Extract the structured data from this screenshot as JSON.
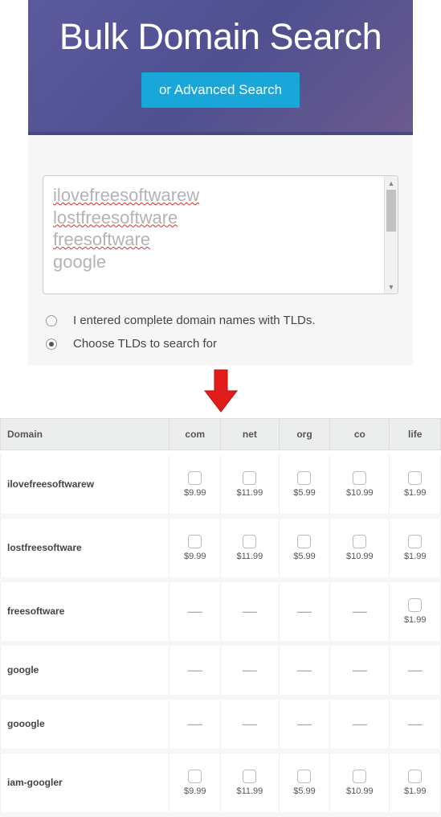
{
  "hero": {
    "title": "Bulk Domain Search",
    "advanced_button": "or Advanced Search"
  },
  "input": {
    "lines": [
      "ilovefreesoftwarew",
      "lostfreesoftware",
      "freesoftware",
      "google"
    ],
    "lines_no_underline": [
      false,
      false,
      false,
      true
    ]
  },
  "options": {
    "opt1": "I entered complete domain names with TLDs.",
    "opt2": "Choose TLDs to search for",
    "selected": 1
  },
  "table": {
    "headers": [
      "Domain",
      "com",
      "net",
      "org",
      "co",
      "life"
    ],
    "rows": [
      {
        "domain": "ilovefreesoftwarew",
        "cells": [
          "$9.99",
          "$11.99",
          "$5.99",
          "$10.99",
          "$1.99"
        ]
      },
      {
        "domain": "lostfreesoftware",
        "cells": [
          "$9.99",
          "$11.99",
          "$5.99",
          "$10.99",
          "$1.99"
        ]
      },
      {
        "domain": "freesoftware",
        "cells": [
          null,
          null,
          null,
          null,
          "$1.99"
        ]
      },
      {
        "domain": "google",
        "cells": [
          null,
          null,
          null,
          null,
          null
        ]
      },
      {
        "domain": "gooogle",
        "cells": [
          null,
          null,
          null,
          null,
          null
        ]
      },
      {
        "domain": "iam-googler",
        "cells": [
          "$9.99",
          "$11.99",
          "$5.99",
          "$10.99",
          "$1.99"
        ]
      }
    ]
  }
}
